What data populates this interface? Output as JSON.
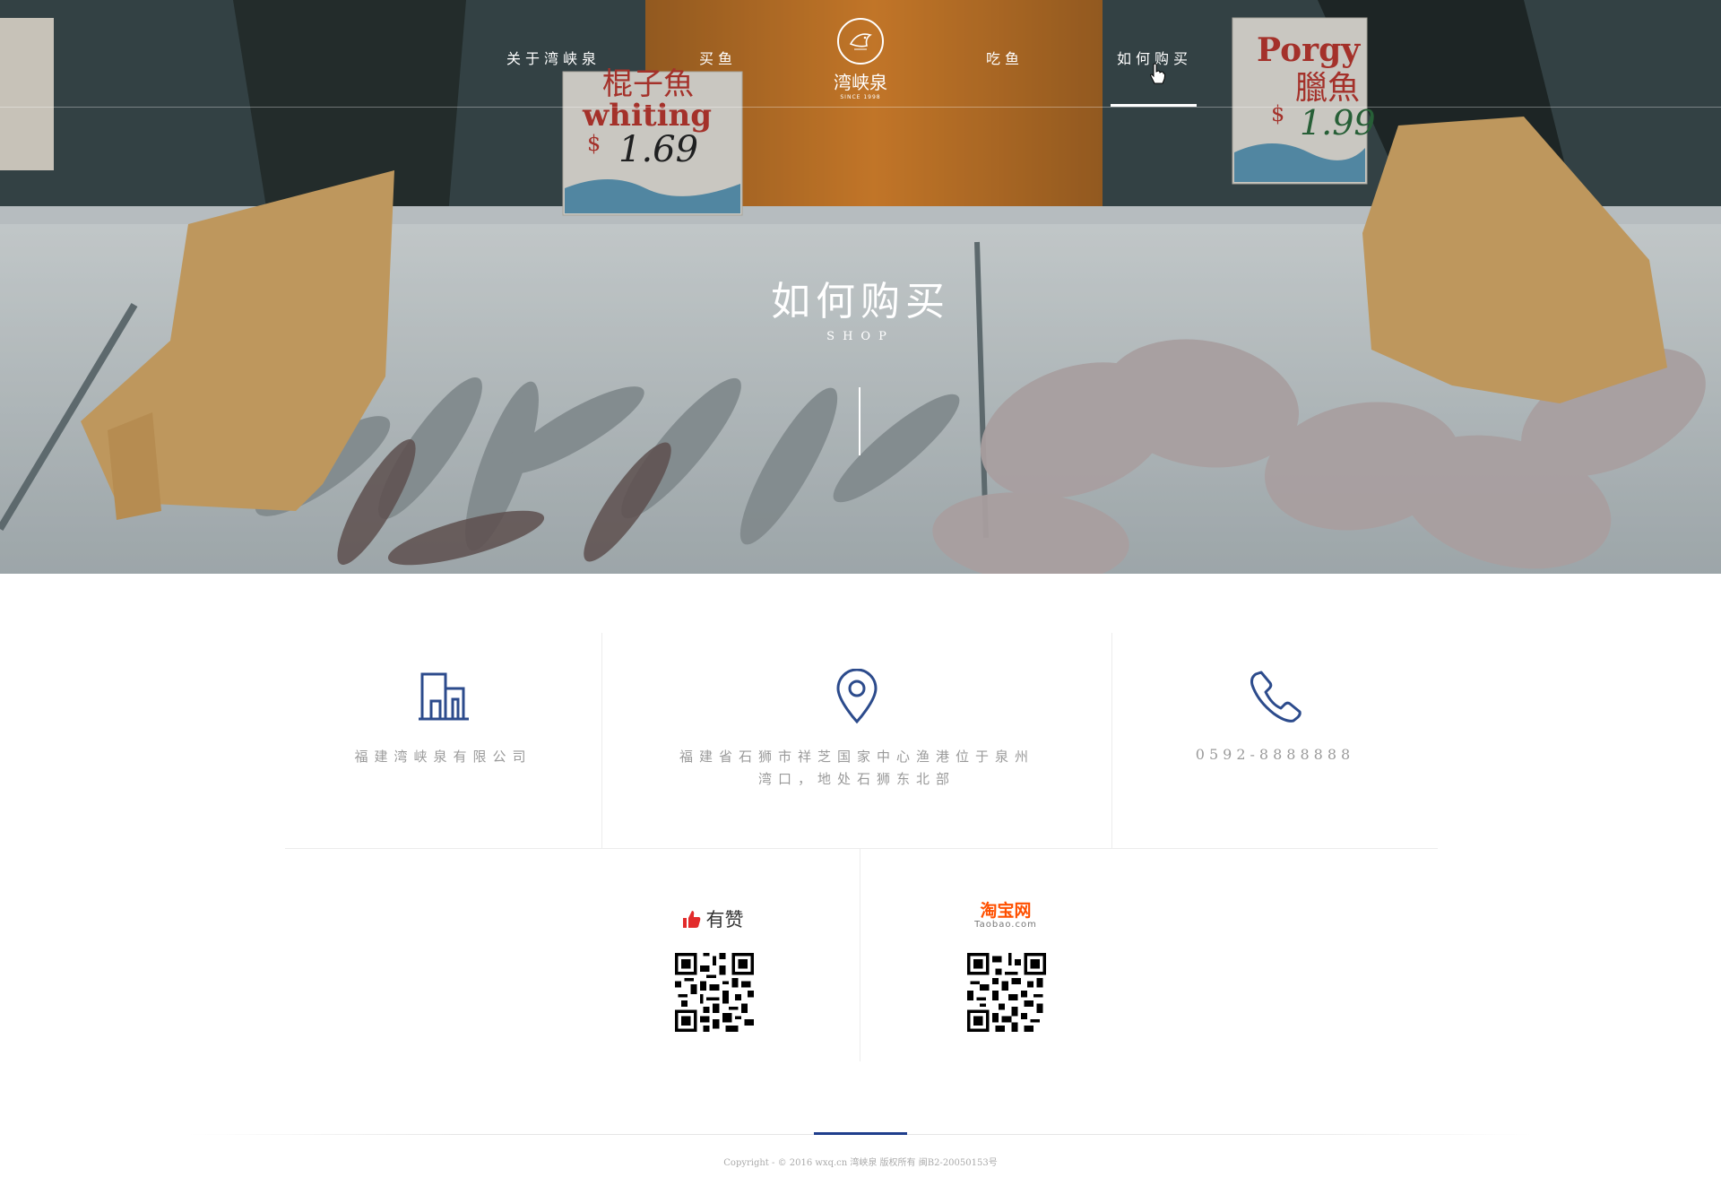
{
  "nav": {
    "items": [
      "关于湾峡泉",
      "买鱼",
      "吃鱼",
      "如何购买"
    ],
    "active": "如何购买",
    "logo_name": "湾峡泉",
    "logo_badge_text": "SINCE 1998"
  },
  "hero": {
    "title": "如何购买",
    "subtitle": "SHOP",
    "sign_left": {
      "chinese": "棍子魚",
      "english": "whiting",
      "price": "$ 1.69"
    },
    "sign_right": {
      "english": "Porgy",
      "chinese": "臘魚",
      "price": "$ 1.99"
    }
  },
  "info": {
    "company": "福建湾峡泉有限公司",
    "address_line1": "福建省石狮市祥芝国家中心渔港位于泉州",
    "address_line2": "湾口，地处石狮东北部",
    "phone": "0592-8888888"
  },
  "stores": {
    "youzan": "有赞",
    "taobao_cn": "淘宝网",
    "taobao_en": "Taobao.com"
  },
  "footer": {
    "copyright": "Copyright - © 2016 wxq.cn 湾峡泉 版权所有 闽B2-20050153号"
  },
  "colors": {
    "accent": "#2c4b8c",
    "taobao": "#ff5000",
    "youzan": "#e22b2b",
    "text": "#9a9a9a"
  }
}
